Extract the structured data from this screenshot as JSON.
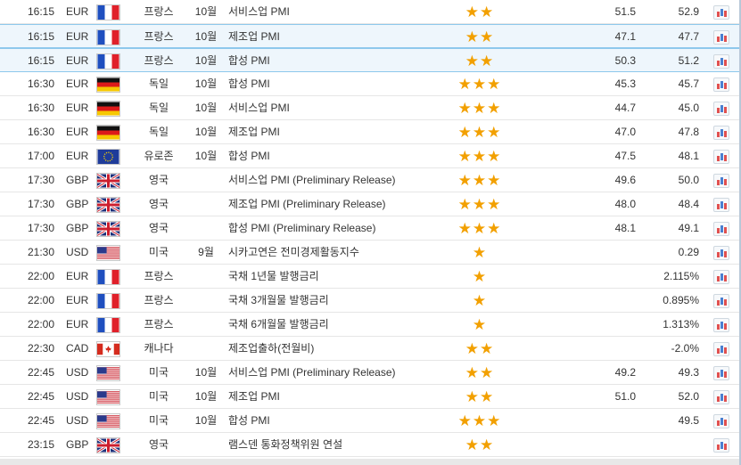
{
  "colors": {
    "star": "#f2a000",
    "selected_row_bg": "#eef6fc",
    "selected_row_border": "#8ec8ec"
  },
  "rows": [
    {
      "time": "16:15",
      "currency": "EUR",
      "flag": "fr",
      "country": "프랑스",
      "month": "10월",
      "event": "서비스업 PMI",
      "stars": "★★",
      "actual": "51.5",
      "forecast": "52.9",
      "selected": false
    },
    {
      "time": "16:15",
      "currency": "EUR",
      "flag": "fr",
      "country": "프랑스",
      "month": "10월",
      "event": "제조업 PMI",
      "stars": "★★",
      "actual": "47.1",
      "forecast": "47.7",
      "selected": true
    },
    {
      "time": "16:15",
      "currency": "EUR",
      "flag": "fr",
      "country": "프랑스",
      "month": "10월",
      "event": "합성 PMI",
      "stars": "★★",
      "actual": "50.3",
      "forecast": "51.2",
      "selected": true
    },
    {
      "time": "16:30",
      "currency": "EUR",
      "flag": "de",
      "country": "독일",
      "month": "10월",
      "event": "합성 PMI",
      "stars": "★★★",
      "actual": "45.3",
      "forecast": "45.7",
      "selected": false
    },
    {
      "time": "16:30",
      "currency": "EUR",
      "flag": "de",
      "country": "독일",
      "month": "10월",
      "event": "서비스업 PMI",
      "stars": "★★★",
      "actual": "44.7",
      "forecast": "45.0",
      "selected": false
    },
    {
      "time": "16:30",
      "currency": "EUR",
      "flag": "de",
      "country": "독일",
      "month": "10월",
      "event": "제조업 PMI",
      "stars": "★★★",
      "actual": "47.0",
      "forecast": "47.8",
      "selected": false
    },
    {
      "time": "17:00",
      "currency": "EUR",
      "flag": "eu",
      "country": "유로존",
      "month": "10월",
      "event": "합성 PMI",
      "stars": "★★★",
      "actual": "47.5",
      "forecast": "48.1",
      "selected": false
    },
    {
      "time": "17:30",
      "currency": "GBP",
      "flag": "uk",
      "country": "영국",
      "month": "",
      "event": "서비스업 PMI (Preliminary Release)",
      "stars": "★★★",
      "actual": "49.6",
      "forecast": "50.0",
      "selected": false
    },
    {
      "time": "17:30",
      "currency": "GBP",
      "flag": "uk",
      "country": "영국",
      "month": "",
      "event": "제조업 PMI (Preliminary Release)",
      "stars": "★★★",
      "actual": "48.0",
      "forecast": "48.4",
      "selected": false
    },
    {
      "time": "17:30",
      "currency": "GBP",
      "flag": "uk",
      "country": "영국",
      "month": "",
      "event": "합성 PMI (Preliminary Release)",
      "stars": "★★★",
      "actual": "48.1",
      "forecast": "49.1",
      "selected": false
    },
    {
      "time": "21:30",
      "currency": "USD",
      "flag": "us",
      "country": "미국",
      "month": "9월",
      "event": "시카고연은 전미경제활동지수",
      "stars": "★",
      "actual": "",
      "forecast": "0.29",
      "selected": false
    },
    {
      "time": "22:00",
      "currency": "EUR",
      "flag": "fr",
      "country": "프랑스",
      "month": "",
      "event": "국채 1년물 발행금리",
      "stars": "★",
      "actual": "",
      "forecast": "2.115%",
      "selected": false
    },
    {
      "time": "22:00",
      "currency": "EUR",
      "flag": "fr",
      "country": "프랑스",
      "month": "",
      "event": "국채 3개월물 발행금리",
      "stars": "★",
      "actual": "",
      "forecast": "0.895%",
      "selected": false
    },
    {
      "time": "22:00",
      "currency": "EUR",
      "flag": "fr",
      "country": "프랑스",
      "month": "",
      "event": "국채 6개월물 발행금리",
      "stars": "★",
      "actual": "",
      "forecast": "1.313%",
      "selected": false
    },
    {
      "time": "22:30",
      "currency": "CAD",
      "flag": "ca",
      "country": "캐나다",
      "month": "",
      "event": "제조업출하(전월비)",
      "stars": "★★",
      "actual": "",
      "forecast": "-2.0%",
      "selected": false
    },
    {
      "time": "22:45",
      "currency": "USD",
      "flag": "us",
      "country": "미국",
      "month": "10월",
      "event": "서비스업 PMI (Preliminary Release)",
      "stars": "★★",
      "actual": "49.2",
      "forecast": "49.3",
      "selected": false
    },
    {
      "time": "22:45",
      "currency": "USD",
      "flag": "us",
      "country": "미국",
      "month": "10월",
      "event": "제조업 PMI",
      "stars": "★★",
      "actual": "51.0",
      "forecast": "52.0",
      "selected": false
    },
    {
      "time": "22:45",
      "currency": "USD",
      "flag": "us",
      "country": "미국",
      "month": "10월",
      "event": "합성 PMI",
      "stars": "★★★",
      "actual": "",
      "forecast": "49.5",
      "selected": false
    },
    {
      "time": "23:15",
      "currency": "GBP",
      "flag": "uk",
      "country": "영국",
      "month": "",
      "event": "램스덴 통화정책위원 연설",
      "stars": "★★",
      "actual": "",
      "forecast": "",
      "selected": false
    }
  ]
}
